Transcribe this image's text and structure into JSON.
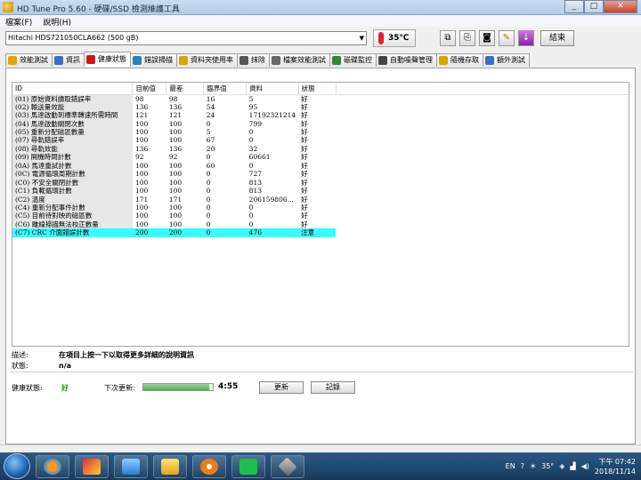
{
  "window": {
    "title": "HD Tune Pro 5.60 - 硬碟/SSD 檢測維護工具"
  },
  "menu": [
    "檔案(F)",
    "說明(H)"
  ],
  "toolbar": {
    "drive": "Hitachi HDS721050CLA662 (500 gB)",
    "temperature": "35℃",
    "exit_label": "結束"
  },
  "tabs": [
    {
      "label": "效能測試",
      "color": "#e0a500"
    },
    {
      "label": "資訊",
      "color": "#3a6fc4"
    },
    {
      "label": "健康狀態",
      "color": "#d0161b"
    },
    {
      "label": "錯誤掃描",
      "color": "#2a7fbf"
    },
    {
      "label": "資料夾使用率",
      "color": "#d9a400"
    },
    {
      "label": "抹除",
      "color": "#555555"
    },
    {
      "label": "檔案效能測試",
      "color": "#666666"
    },
    {
      "label": "磁碟監控",
      "color": "#2c8a2c"
    },
    {
      "label": "自動噪聲管理",
      "color": "#444444"
    },
    {
      "label": "隨機存取",
      "color": "#d9a400"
    },
    {
      "label": "額外測試",
      "color": "#3a6fc4"
    }
  ],
  "smart": {
    "headers": [
      "ID",
      "目前值",
      "最差",
      "臨界值",
      "資料",
      "狀態"
    ],
    "rows": [
      [
        "(01) 原始資料讀取錯誤率",
        "98",
        "98",
        "16",
        "5",
        "好"
      ],
      [
        "(02) 輸送量效能",
        "136",
        "136",
        "54",
        "95",
        "好"
      ],
      [
        "(03) 馬達啟動到標準轉速所需時間",
        "121",
        "121",
        "24",
        "17192321214",
        "好"
      ],
      [
        "(04) 馬達啟動關閉次數",
        "100",
        "100",
        "0",
        "799",
        "好"
      ],
      [
        "(05) 重新分配磁區數量",
        "100",
        "100",
        "5",
        "0",
        "好"
      ],
      [
        "(07) 尋軌錯誤率",
        "100",
        "100",
        "67",
        "0",
        "好"
      ],
      [
        "(08) 尋軌效能",
        "136",
        "136",
        "20",
        "32",
        "好"
      ],
      [
        "(09) 開機時間計數",
        "92",
        "92",
        "0",
        "60661",
        "好"
      ],
      [
        "(0A) 馬達重試計數",
        "100",
        "100",
        "60",
        "0",
        "好"
      ],
      [
        "(0C) 電源循環周期計數",
        "100",
        "100",
        "0",
        "727",
        "好"
      ],
      [
        "(C0) 不安全關閉計數",
        "100",
        "100",
        "0",
        "813",
        "好"
      ],
      [
        "(C1) 負載循環計數",
        "100",
        "100",
        "0",
        "813",
        "好"
      ],
      [
        "(C2) 溫度",
        "171",
        "171",
        "0",
        "206159806...",
        "好"
      ],
      [
        "(C4) 重新分配事件計數",
        "100",
        "100",
        "0",
        "0",
        "好"
      ],
      [
        "(C5) 目前待對映的磁區數",
        "100",
        "100",
        "0",
        "0",
        "好"
      ],
      [
        "(C6) 離線掃描無法校正數量",
        "100",
        "100",
        "0",
        "0",
        "好"
      ],
      [
        "(C7) CRC 介面錯誤計數",
        "200",
        "200",
        "0",
        "476",
        "注意"
      ]
    ],
    "highlight_color": "#33ffff"
  },
  "description": {
    "desc_label": "描述:",
    "desc_value": "在項目上按一下以取得更多詳細的說明資訊",
    "status_label": "狀態:",
    "status_value": "n/a"
  },
  "health": {
    "label": "健康狀態:",
    "value": "好",
    "value_color": "#0aa300",
    "next_update_label": "下次更新:",
    "progress": 0.95,
    "countdown": "4:55",
    "update_button": "更新",
    "log_button": "記錄"
  },
  "taskbar": {
    "apps": [
      "media-player",
      "photo-viewer",
      "file-explorer",
      "video-player",
      "line-messenger",
      "hd-tune"
    ],
    "tray": {
      "lang": "EN",
      "weather": "35°",
      "time": "下午 07:42",
      "date": "2018/11/14"
    }
  }
}
